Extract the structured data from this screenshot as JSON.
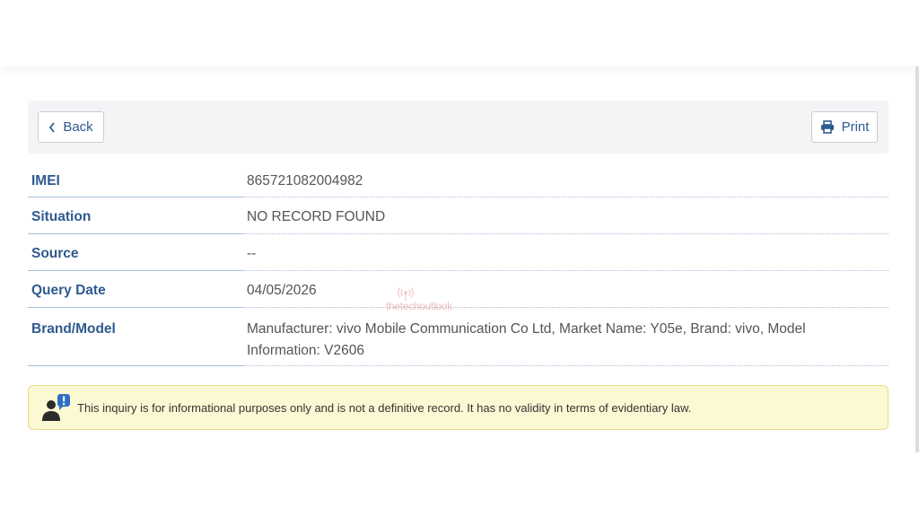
{
  "toolbar": {
    "back_label": "Back",
    "print_label": "Print"
  },
  "details": [
    {
      "label": "IMEI",
      "value": "865721082004982"
    },
    {
      "label": "Situation",
      "value": "NO RECORD FOUND"
    },
    {
      "label": "Source",
      "value": "--"
    },
    {
      "label": "Query Date",
      "value": "04/05/2026"
    },
    {
      "label": "Brand/Model",
      "value": "Manufacturer: vivo Mobile Communication Co Ltd, Market Name: Y05e, Brand: vivo, Model Information: V2606"
    }
  ],
  "notice": {
    "text": "This inquiry is for informational purposes only and is not a definitive record. It has no validity in terms of evidentiary law.",
    "icon": "user-alert-icon"
  },
  "watermark": {
    "text": "thetechoutlook"
  },
  "colors": {
    "label_blue": "#2f5a8f",
    "notice_bg": "#fcf8d4",
    "notice_border": "#e7df7e",
    "toolbar_bg": "#f3f4f6"
  }
}
